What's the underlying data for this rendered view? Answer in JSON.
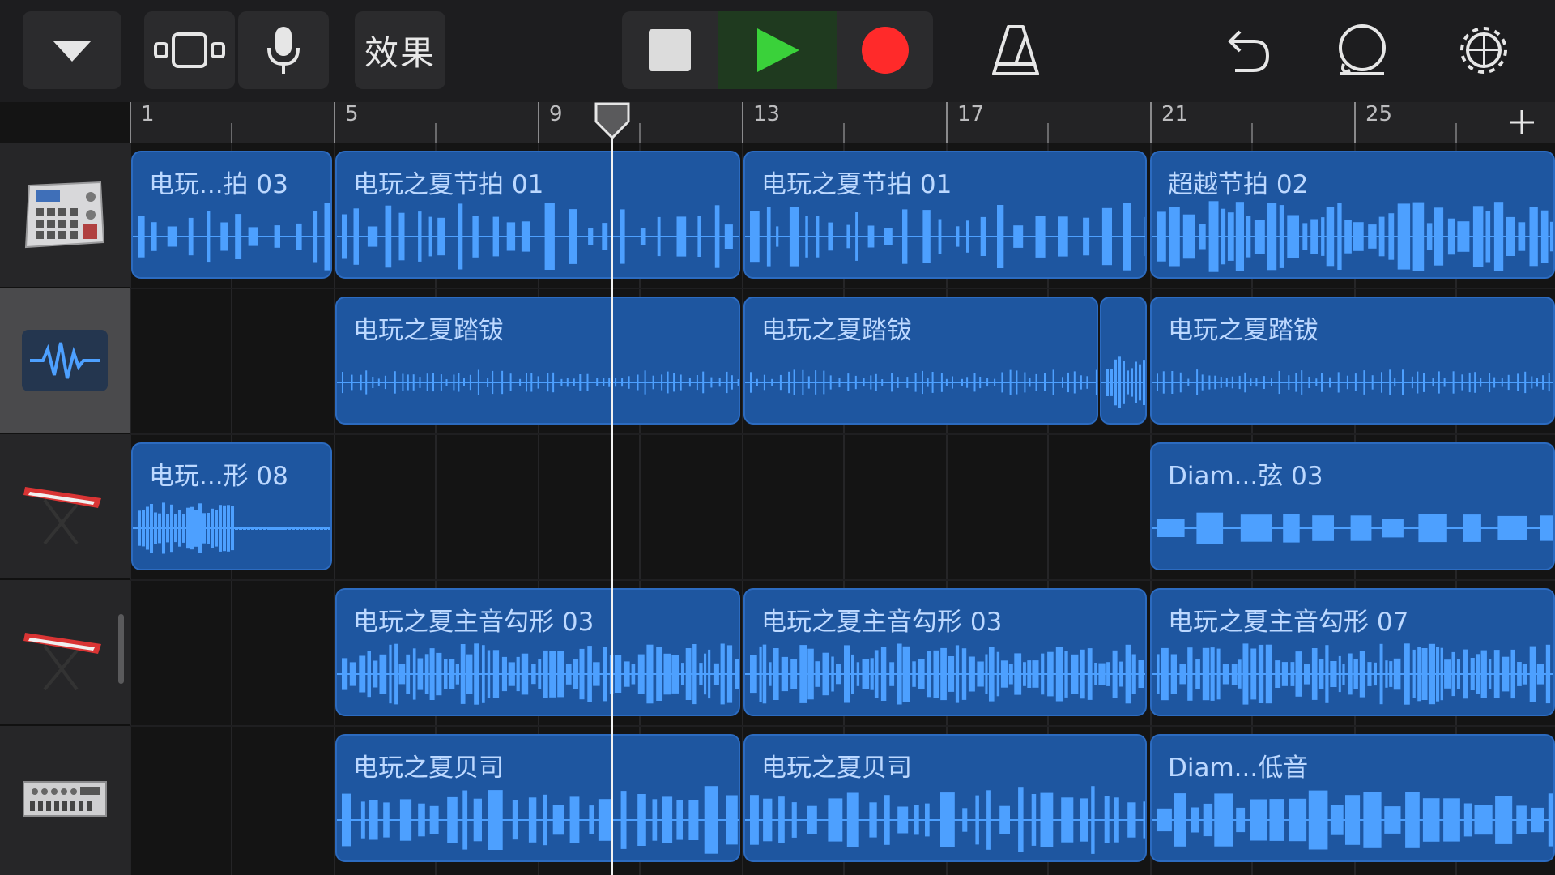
{
  "toolbar": {
    "fx_label": "效果",
    "accent_record": "#ff2a2a",
    "accent_play": "#3ad13a",
    "icons": [
      "chevron-down-icon",
      "tracks-view-icon",
      "microphone-icon",
      "stop-icon",
      "play-icon",
      "record-icon",
      "metronome-icon",
      "undo-icon",
      "loop-browser-icon",
      "settings-gear-icon"
    ]
  },
  "ruler": {
    "numbers": [
      "1",
      "5",
      "9",
      "13",
      "17",
      "21",
      "25"
    ],
    "add_label": "+"
  },
  "tracks": [
    {
      "instrument": "drum-machine-icon",
      "regions": [
        {
          "label": "电玩...拍 03"
        },
        {
          "label": "电玩之夏节拍 01"
        },
        {
          "label": "电玩之夏节拍 01"
        },
        {
          "label": "超越节拍 02"
        }
      ]
    },
    {
      "instrument": "waveform-icon",
      "regions": [
        {
          "label": "电玩之夏踏钹"
        },
        {
          "label": "电玩之夏踏钹"
        },
        {
          "label": ""
        },
        {
          "label": "电玩之夏踏钹"
        }
      ]
    },
    {
      "instrument": "keyboard-synth-icon",
      "regions": [
        {
          "label": "电玩...形 08"
        },
        {
          "label": "Diam...弦 03"
        }
      ]
    },
    {
      "instrument": "keyboard-synth-icon",
      "regions": [
        {
          "label": "电玩之夏主音勾形 03"
        },
        {
          "label": "电玩之夏主音勾形 03"
        },
        {
          "label": "电玩之夏主音勾形 07"
        }
      ]
    },
    {
      "instrument": "bass-synth-icon",
      "regions": [
        {
          "label": "电玩之夏贝司"
        },
        {
          "label": "电玩之夏贝司"
        },
        {
          "label": "Diam...低音"
        }
      ]
    }
  ],
  "playhead": {
    "bar": 10.4
  }
}
